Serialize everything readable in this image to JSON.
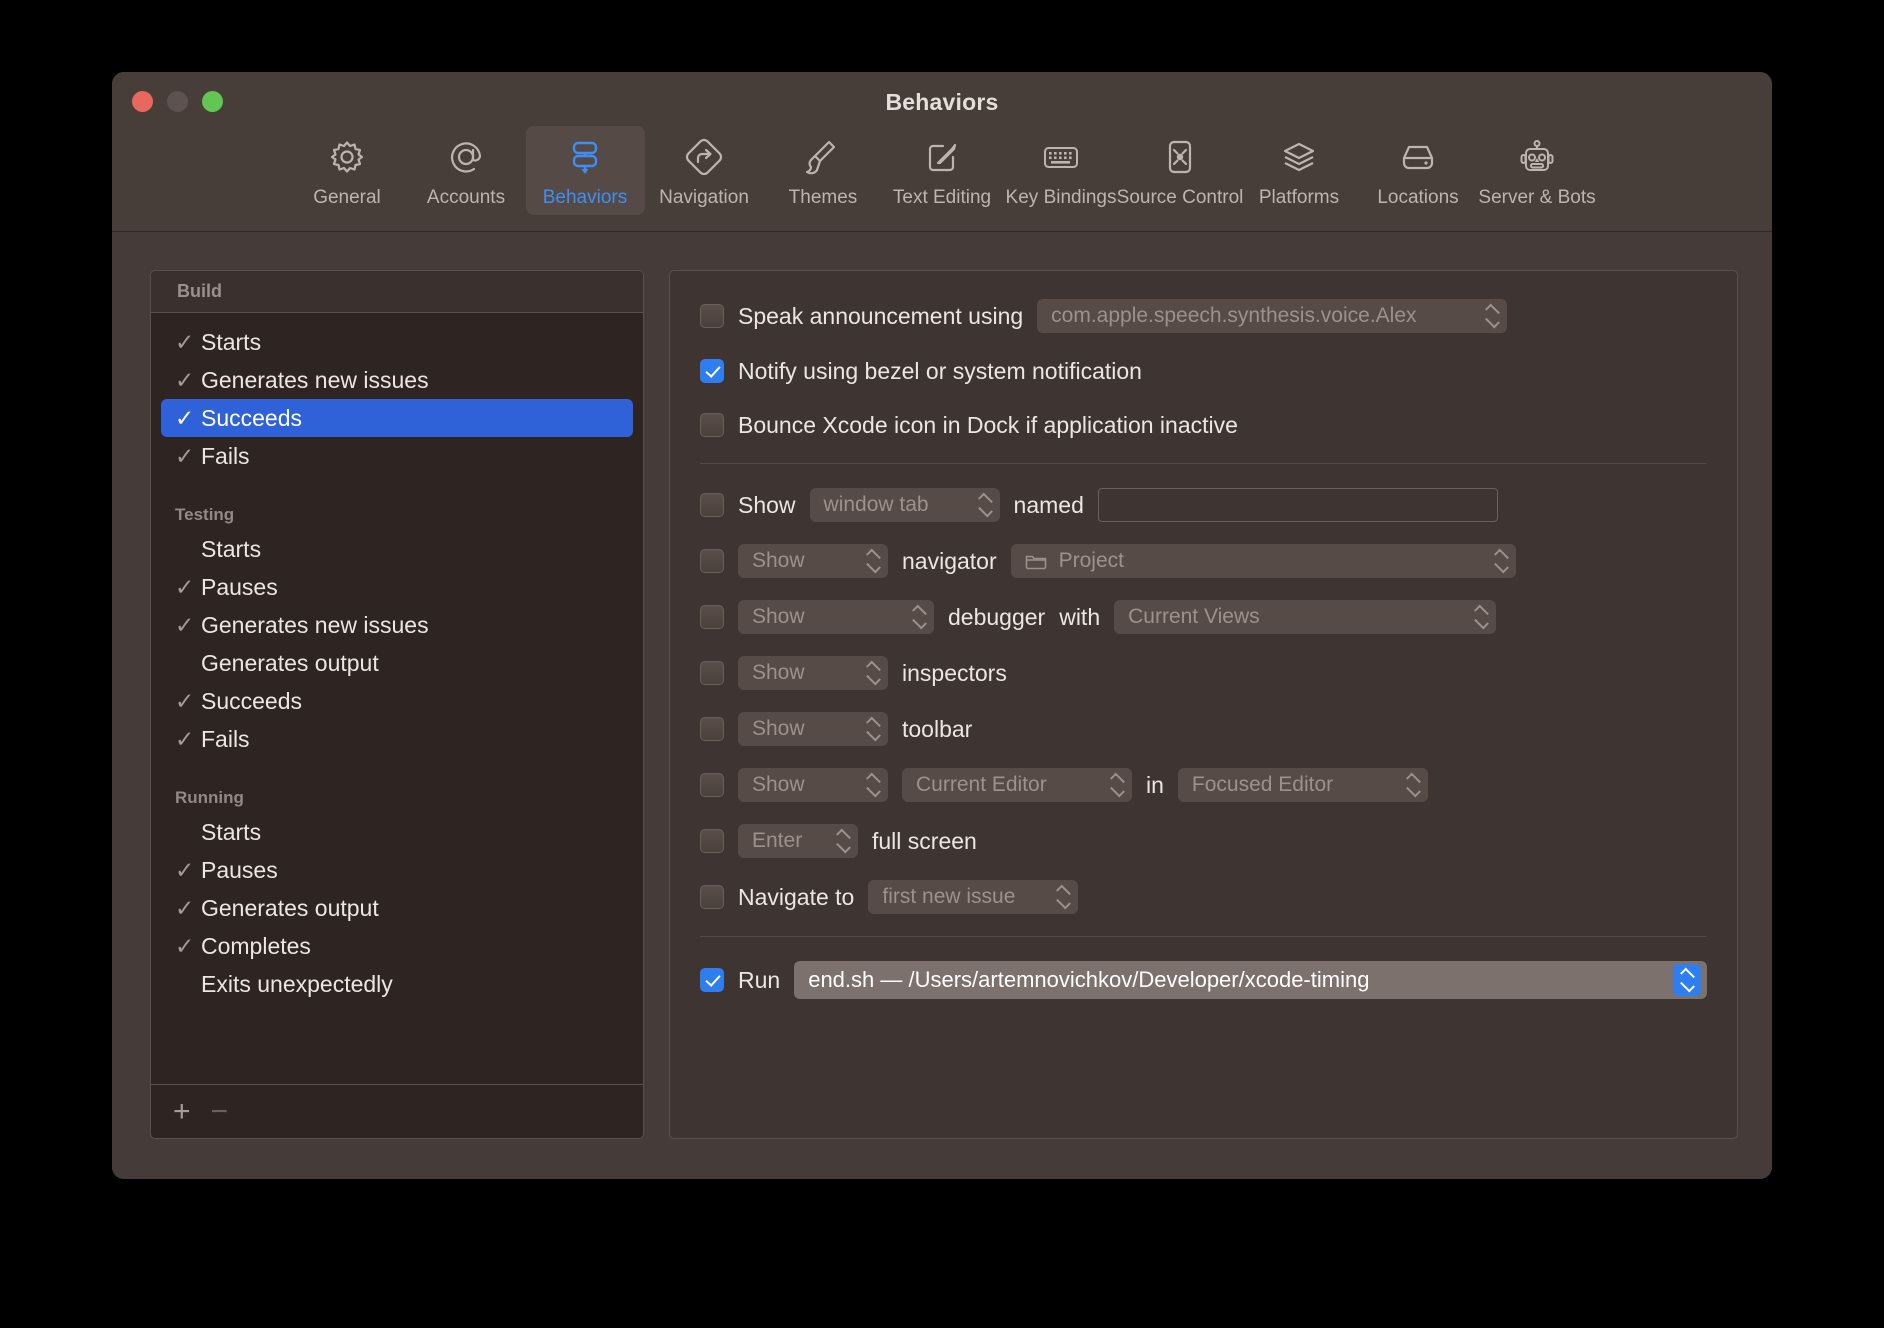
{
  "window": {
    "title": "Behaviors",
    "traffic": {
      "close": "close-button",
      "minimize": "minimize-button",
      "zoom": "zoom-button"
    }
  },
  "toolbar": {
    "items": [
      {
        "label": "General",
        "icon": "gear-icon",
        "active": false
      },
      {
        "label": "Accounts",
        "icon": "at-sign-icon",
        "active": false
      },
      {
        "label": "Behaviors",
        "icon": "behaviors-icon",
        "active": true
      },
      {
        "label": "Navigation",
        "icon": "navigation-sign-icon",
        "active": false
      },
      {
        "label": "Themes",
        "icon": "paintbrush-icon",
        "active": false
      },
      {
        "label": "Text Editing",
        "icon": "pencil-square-icon",
        "active": false
      },
      {
        "label": "Key Bindings",
        "icon": "keyboard-icon",
        "active": false
      },
      {
        "label": "Source Control",
        "icon": "source-control-icon",
        "active": false
      },
      {
        "label": "Platforms",
        "icon": "layers-icon",
        "active": false
      },
      {
        "label": "Locations",
        "icon": "disk-icon",
        "active": false
      },
      {
        "label": "Server & Bots",
        "icon": "robot-icon",
        "active": false
      }
    ]
  },
  "sidebar": {
    "header": "Build",
    "groups": [
      {
        "title": "",
        "items": [
          {
            "label": "Starts",
            "checked": true,
            "selected": false
          },
          {
            "label": "Generates new issues",
            "checked": true,
            "selected": false
          },
          {
            "label": "Succeeds",
            "checked": true,
            "selected": true
          },
          {
            "label": "Fails",
            "checked": true,
            "selected": false
          }
        ]
      },
      {
        "title": "Testing",
        "items": [
          {
            "label": "Starts",
            "checked": false,
            "selected": false
          },
          {
            "label": "Pauses",
            "checked": true,
            "selected": false
          },
          {
            "label": "Generates new issues",
            "checked": true,
            "selected": false
          },
          {
            "label": "Generates output",
            "checked": false,
            "selected": false
          },
          {
            "label": "Succeeds",
            "checked": true,
            "selected": false
          },
          {
            "label": "Fails",
            "checked": true,
            "selected": false
          }
        ]
      },
      {
        "title": "Running",
        "items": [
          {
            "label": "Starts",
            "checked": false,
            "selected": false
          },
          {
            "label": "Pauses",
            "checked": true,
            "selected": false
          },
          {
            "label": "Generates output",
            "checked": true,
            "selected": false
          },
          {
            "label": "Completes",
            "checked": true,
            "selected": false
          },
          {
            "label": "Exits unexpectedly",
            "checked": false,
            "selected": false
          }
        ]
      }
    ],
    "footer": {
      "add_label": "+",
      "remove_label": "−"
    },
    "check_glyph": "✓"
  },
  "detail": {
    "speak": {
      "label": "Speak announcement using",
      "checked": false,
      "voice": "com.apple.speech.synthesis.voice.Alex"
    },
    "notify": {
      "label": "Notify using bezel or system notification",
      "checked": true
    },
    "bounce": {
      "label": "Bounce Xcode icon in Dock if application inactive",
      "checked": false
    },
    "show_tab": {
      "checked": false,
      "show_label": "Show",
      "target": "window tab",
      "named_label": "named",
      "name_value": ""
    },
    "navigator": {
      "checked": false,
      "action": "Show",
      "label": "navigator",
      "value": "Project",
      "value_icon": "folder-icon"
    },
    "debugger": {
      "checked": false,
      "action": "Show",
      "label": "debugger",
      "with_label": "with",
      "value": "Current Views"
    },
    "inspectors": {
      "checked": false,
      "action": "Show",
      "label": "inspectors"
    },
    "toolbar_row": {
      "checked": false,
      "action": "Show",
      "label": "toolbar"
    },
    "editor": {
      "checked": false,
      "action": "Show",
      "what": "Current Editor",
      "in_label": "in",
      "where": "Focused Editor"
    },
    "fullscreen": {
      "checked": false,
      "action": "Enter",
      "label": "full screen"
    },
    "navigate": {
      "checked": false,
      "label": "Navigate to",
      "value": "first new issue"
    },
    "run": {
      "checked": true,
      "label": "Run",
      "value": "end.sh — /Users/artemnovichkov/Developer/xcode-timing"
    }
  },
  "colors": {
    "accent": "#2f7ef0",
    "selection": "#2f62d8",
    "window_bg": "#453b38",
    "list_bg": "#2e2522",
    "detail_bg": "#3e3431"
  }
}
